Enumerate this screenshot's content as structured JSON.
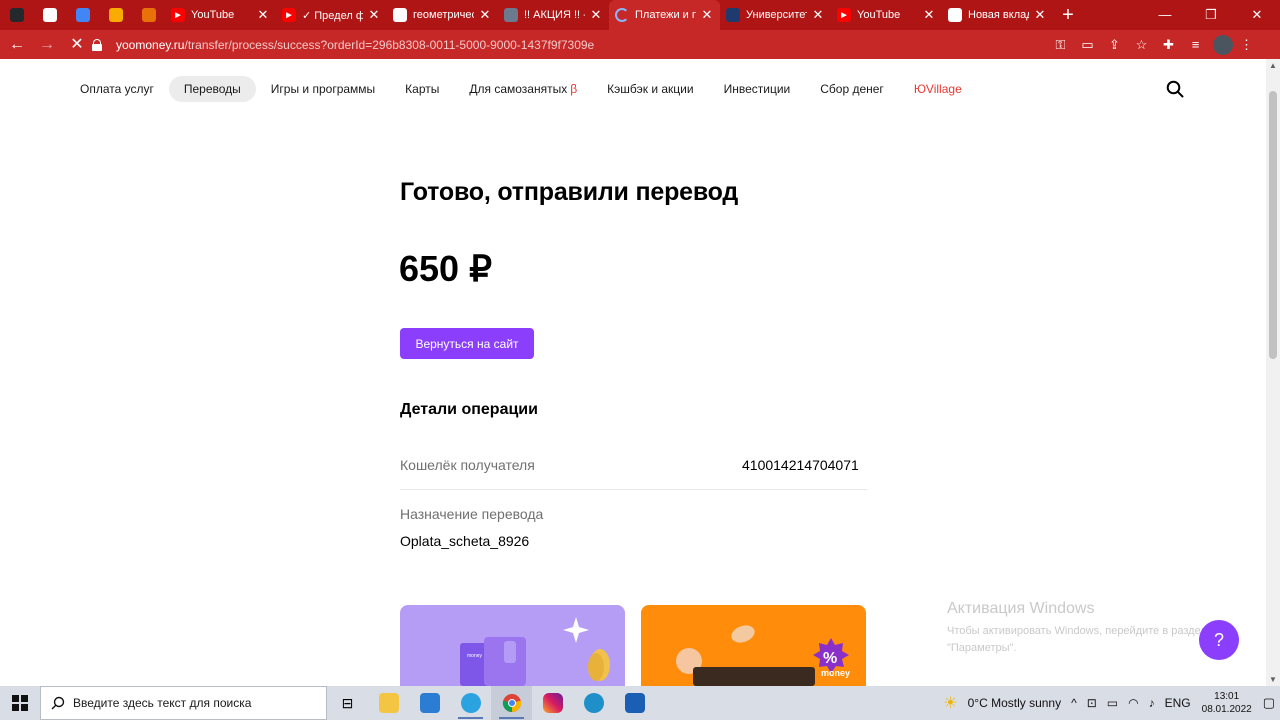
{
  "browser": {
    "tabs": [
      {
        "title": "",
        "favicon": "github",
        "color": "#24292e",
        "pinned": true
      },
      {
        "title": "",
        "favicon": "gmail",
        "color": "#ffffff",
        "pinned": true
      },
      {
        "title": "",
        "favicon": "grid",
        "color": "#4285f4",
        "pinned": true
      },
      {
        "title": "",
        "favicon": "bookmark",
        "color": "#f9ab00",
        "pinned": true
      },
      {
        "title": "",
        "favicon": "lightning",
        "color": "#e8710a",
        "pinned": true
      },
      {
        "title": "YouTube",
        "favicon": "youtube",
        "color": "#ff0000"
      },
      {
        "title": "✓ Предел фу",
        "favicon": "youtube",
        "color": "#ff0000"
      },
      {
        "title": "геометричес",
        "favicon": "google",
        "color": "#ffffff"
      },
      {
        "title": "!! АКЦИЯ !! -",
        "favicon": "image",
        "color": "#6b7a8f"
      },
      {
        "title": "Платежи и п",
        "favicon": "loading",
        "color": "#8ab4f8",
        "active": true
      },
      {
        "title": "Университет",
        "favicon": "university",
        "color": "#1e3a6e"
      },
      {
        "title": "YouTube",
        "favicon": "youtube",
        "color": "#ff0000"
      },
      {
        "title": "Новая вклад",
        "favicon": "chrome",
        "color": "#ffffff"
      }
    ],
    "url_host": "yoomoney.ru",
    "url_path": "/transfer/process/success?orderId=296b8308-0011-5000-9000-1437f9f7309e"
  },
  "site_nav": {
    "items": [
      {
        "label": "Оплата услуг"
      },
      {
        "label": "Переводы",
        "active": true
      },
      {
        "label": "Игры и программы"
      },
      {
        "label": "Карты"
      },
      {
        "label": "Для самозанятых",
        "badge": "β"
      },
      {
        "label": "Кэшбэк и акции"
      },
      {
        "label": "Инвестиции"
      },
      {
        "label": "Сбор денег"
      },
      {
        "label": "ЮVillage",
        "red": true
      }
    ]
  },
  "content": {
    "heading": "Готово, отправили перевод",
    "amount": "650 ₽",
    "back_button": "Вернуться на сайт",
    "details_title": "Детали операции",
    "wallet_label": "Кошелёк получателя",
    "wallet_value": "410014214704071",
    "purpose_label": "Назначение перевода",
    "purpose_value": "Oplata_scheta_8926",
    "card_brand": "money",
    "card_badge": "%"
  },
  "watermark": {
    "title": "Активация Windows",
    "text": "Чтобы активировать Windows, перейдите в раздел \"Параметры\"."
  },
  "help_button": "?",
  "taskbar": {
    "search_placeholder": "Введите здесь текст для поиска",
    "weather": "0°C  Mostly sunny",
    "language": "ENG",
    "time": "13:01",
    "date": "08.01.2022"
  },
  "colors": {
    "accent": "#8b3ffd",
    "browser_frame": "#b01515",
    "toolbar": "#c62828",
    "card_purple": "#b59cf5",
    "card_orange": "#ff8c0a"
  }
}
